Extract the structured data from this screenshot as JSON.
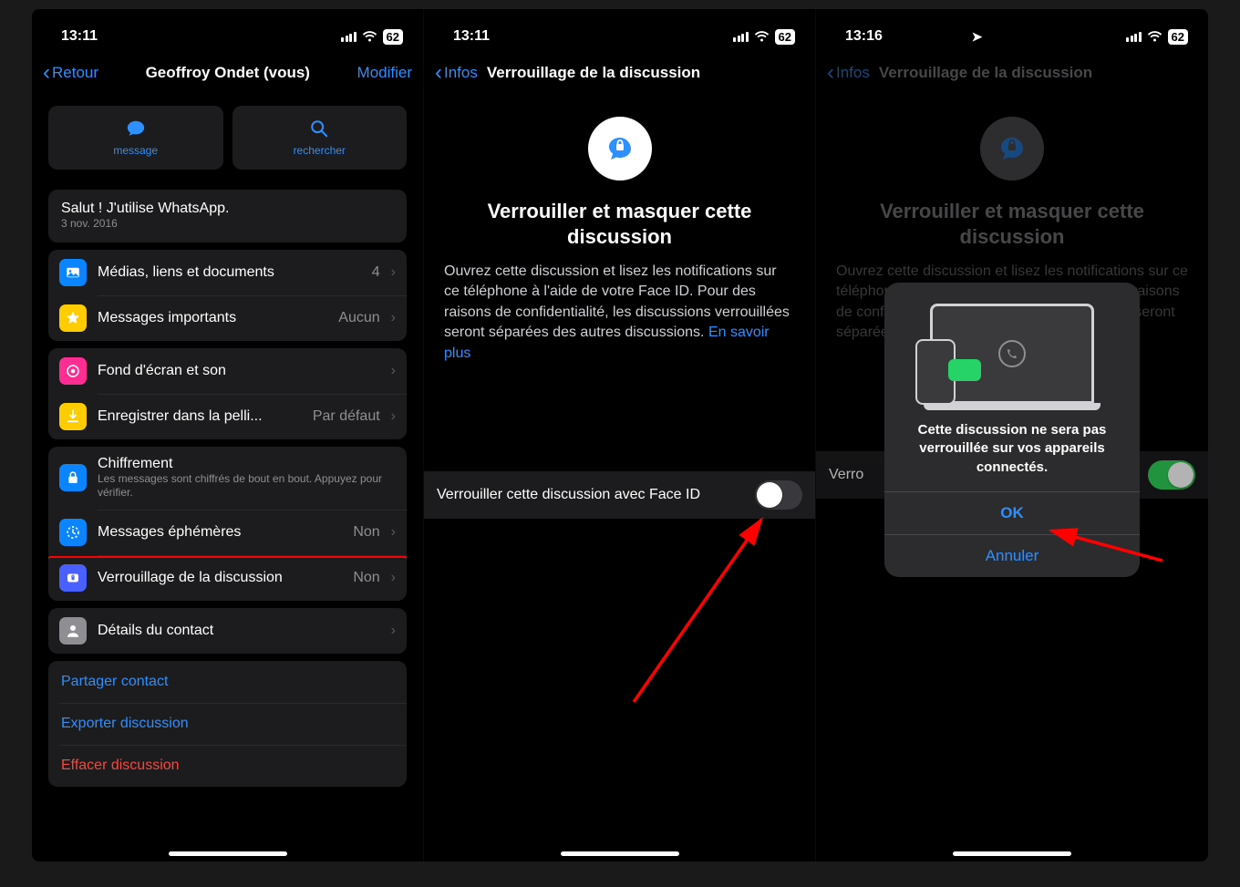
{
  "screen1": {
    "status": {
      "time": "13:11",
      "battery": "62"
    },
    "nav": {
      "back": "Retour",
      "title": "Geoffroy Ondet (vous)",
      "action": "Modifier"
    },
    "actions": {
      "message": "message",
      "search": "rechercher"
    },
    "statusLine": {
      "text": "Salut ! J'utilise WhatsApp.",
      "date": "3 nov. 2016"
    },
    "rows": {
      "media": {
        "label": "Médias, liens et documents",
        "detail": "4"
      },
      "starred": {
        "label": "Messages importants",
        "detail": "Aucun"
      },
      "wallpaper": {
        "label": "Fond d'écran et son"
      },
      "save": {
        "label": "Enregistrer dans la pelli...",
        "detail": "Par défaut"
      },
      "encryption": {
        "label": "Chiffrement",
        "sub": "Les messages sont chiffrés de bout en bout. Appuyez pour vérifier."
      },
      "ephemeral": {
        "label": "Messages éphémères",
        "detail": "Non"
      },
      "lock": {
        "label": "Verrouillage de la discussion",
        "detail": "Non"
      },
      "details": {
        "label": "Détails du contact"
      },
      "share": "Partager contact",
      "export": "Exporter discussion",
      "erase": "Effacer discussion"
    }
  },
  "screen2": {
    "status": {
      "time": "13:11",
      "battery": "62"
    },
    "nav": {
      "back": "Infos",
      "title": "Verrouillage de la discussion"
    },
    "hero": {
      "title": "Verrouiller et masquer cette discussion",
      "desc": "Ouvrez cette discussion et lisez les notifications sur ce téléphone à l'aide de votre Face ID. Pour des raisons de confidentialité, les discussions verrouillées seront séparées des autres discussions.",
      "link": "En savoir plus"
    },
    "toggle": {
      "label": "Verrouiller cette discussion avec Face ID"
    }
  },
  "screen3": {
    "status": {
      "time": "13:16",
      "battery": "62"
    },
    "nav": {
      "back": "Infos",
      "title": "Verrouillage de la discussion"
    },
    "hero": {
      "title": "Verrouiller et masquer cette discussion",
      "descPartial": "Ouvrez cette discussion et lisez les notifications sur ce téléphone à l'aide de votre Face ID. Pour des raisons de confidentialité, les discussions verrouillées seront séparées des autres discussions."
    },
    "toggleLabelPartial": "Verro",
    "popup": {
      "text": "Cette discussion ne sera pas verrouillée sur vos appareils connectés.",
      "ok": "OK",
      "cancel": "Annuler"
    }
  }
}
